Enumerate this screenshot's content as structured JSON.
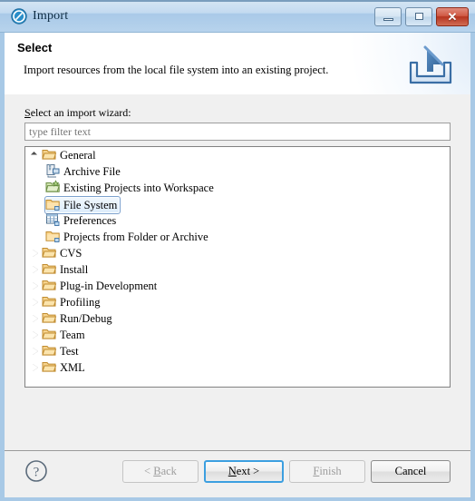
{
  "window": {
    "title": "Import",
    "app_icon": "eclipse-icon",
    "controls": {
      "minimize": "minimize-button",
      "maximize": "maximize-button",
      "close_label": "✕"
    }
  },
  "header": {
    "title": "Select",
    "description": "Import resources from the local file system into an existing project.",
    "banner_icon": "import-arrow-into-tray-icon"
  },
  "main": {
    "filter_label_mnemonic": "S",
    "filter_label_rest": "elect an import wizard:",
    "filter_input_value": "",
    "filter_input_placeholder": "type filter text",
    "tree": [
      {
        "label": "General",
        "icon": "folder-open-icon",
        "level": 0,
        "state": "expanded",
        "selected": false
      },
      {
        "label": "Archive File",
        "icon": "archive-file-icon",
        "level": 1,
        "state": "leaf",
        "selected": false
      },
      {
        "label": "Existing Projects into Workspace",
        "icon": "existing-projects-icon",
        "level": 1,
        "state": "leaf",
        "selected": false
      },
      {
        "label": "File System",
        "icon": "folder-icon",
        "level": 1,
        "state": "leaf",
        "selected": true
      },
      {
        "label": "Preferences",
        "icon": "preferences-table-icon",
        "level": 1,
        "state": "leaf",
        "selected": false
      },
      {
        "label": "Projects from Folder or Archive",
        "icon": "folder-icon",
        "level": 1,
        "state": "leaf",
        "selected": false
      },
      {
        "label": "CVS",
        "icon": "folder-open-icon",
        "level": 0,
        "state": "collapsed",
        "selected": false
      },
      {
        "label": "Install",
        "icon": "folder-open-icon",
        "level": 0,
        "state": "collapsed",
        "selected": false
      },
      {
        "label": "Plug-in Development",
        "icon": "folder-open-icon",
        "level": 0,
        "state": "collapsed",
        "selected": false
      },
      {
        "label": "Profiling",
        "icon": "folder-open-icon",
        "level": 0,
        "state": "collapsed",
        "selected": false
      },
      {
        "label": "Run/Debug",
        "icon": "folder-open-icon",
        "level": 0,
        "state": "collapsed",
        "selected": false
      },
      {
        "label": "Team",
        "icon": "folder-open-icon",
        "level": 0,
        "state": "collapsed",
        "selected": false
      },
      {
        "label": "Test",
        "icon": "folder-open-icon",
        "level": 0,
        "state": "collapsed",
        "selected": false
      },
      {
        "label": "XML",
        "icon": "folder-open-icon",
        "level": 0,
        "state": "collapsed",
        "selected": false
      }
    ]
  },
  "footer": {
    "help_icon": "help-question-icon",
    "buttons": [
      {
        "name": "back",
        "mnemonic": "B",
        "before": "< ",
        "after": "ack",
        "enabled": false,
        "default": false
      },
      {
        "name": "next",
        "mnemonic": "N",
        "before": "",
        "after": "ext >",
        "enabled": true,
        "default": true
      },
      {
        "name": "finish",
        "mnemonic": "F",
        "before": "",
        "after": "inish",
        "enabled": false,
        "default": false
      },
      {
        "name": "cancel",
        "mnemonic": "",
        "before": "Cancel",
        "after": "",
        "enabled": true,
        "default": false
      }
    ]
  },
  "colors": {
    "accent_focus": "#3c9fe0",
    "titlebar": "#b7d3ec",
    "frame": "#a8c9e6",
    "close_button": "#b6341f",
    "selection_fill": "#dcecfb",
    "selection_border": "#7da2ce",
    "dialog_background": "#f0f0f0"
  }
}
